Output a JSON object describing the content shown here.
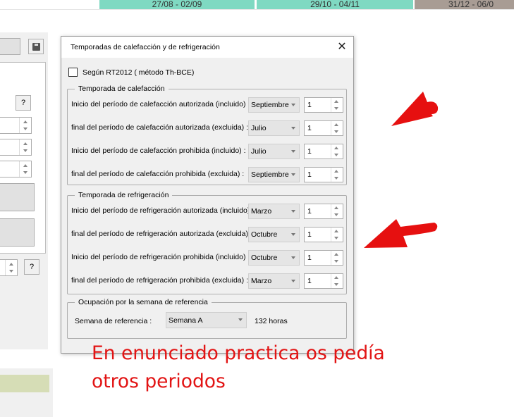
{
  "background": {
    "timeline": [
      "27/08 - 02/09",
      "29/10 - 04/11",
      "31/12 - 06/0"
    ],
    "left_window": {
      "help_button_label": "?"
    }
  },
  "dialog": {
    "title": "Temporadas de calefacción y de refrigeración",
    "close_glyph": "✕",
    "rt2012_checkbox": {
      "label": "Según RT2012 ( método Th-BCE)",
      "checked": false
    },
    "heating": {
      "legend": "Temporada de calefacción",
      "rows": [
        {
          "label": "Inicio del período de calefacción autorizada (incluido) :",
          "month": "Septiembre",
          "day": "1"
        },
        {
          "label": "final del período de calefacción autorizada (excluida) :",
          "month": "Julio",
          "day": "1"
        },
        {
          "label": "Inicio del período de calefacción prohibida (incluido) :",
          "month": "Julio",
          "day": "1"
        },
        {
          "label": "final del período de calefacción prohibida (excluida) :",
          "month": "Septiembre",
          "day": "1"
        }
      ]
    },
    "cooling": {
      "legend": "Temporada de refrigeración",
      "rows": [
        {
          "label": "Inicio del período de refrigeración autorizada (incluido) :",
          "month": "Marzo",
          "day": "1"
        },
        {
          "label": "final del período de refrigeración autorizada (excluida) :",
          "month": "Octubre",
          "day": "1"
        },
        {
          "label": "Inicio del período de refrigeración prohibida (incluido) :",
          "month": "Octubre",
          "day": "1"
        },
        {
          "label": "final del período de refrigeración prohibida (excluida) :",
          "month": "Marzo",
          "day": "1"
        }
      ]
    },
    "occupancy": {
      "legend": "Ocupación por la semana de referencia",
      "label": "Semana de referencia :",
      "week": "Semana A",
      "hours": "132 horas"
    }
  },
  "annotation": {
    "lines": [
      "En enunciado practica os pedía",
      "otros  periodos"
    ],
    "color": "#e21414",
    "arrow_icons": [
      "arrow-pointing-to-heating-section",
      "arrow-pointing-to-cooling-section"
    ]
  }
}
